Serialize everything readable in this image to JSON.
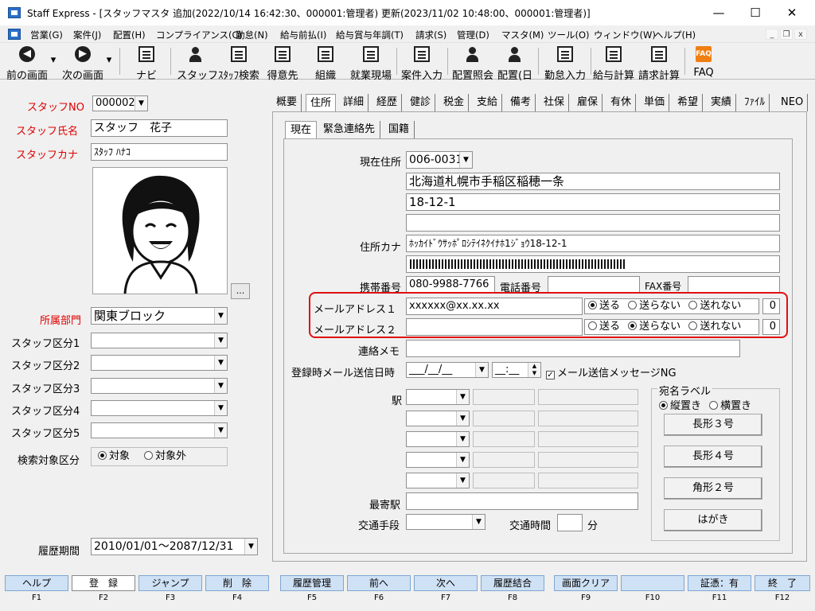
{
  "window": {
    "title": "Staff Express - [スタッフマスタ 追加(2022/10/14 16:42:30、000001:管理者) 更新(2023/11/02 10:48:00、000001:管理者)]",
    "minimize": "—",
    "maximize": "☐",
    "close": "✕"
  },
  "menu": {
    "items": [
      "営業(G)",
      "案件(J)",
      "配置(H)",
      "コンプライアンス(C)",
      "勤怠(N)",
      "給与前払(I)",
      "給与賞与年調(T)",
      "請求(S)",
      "管理(D)",
      "マスタ(M)",
      "ツール(O)",
      "ウィンドウ(W)",
      "ヘルプ(H)"
    ],
    "mdi_min": "_",
    "mdi_restore": "❐",
    "mdi_close": "x"
  },
  "toolbar": {
    "prev": "前の画面",
    "next": "次の画面",
    "navi": "ナビ",
    "staff": "スタッフ",
    "staff_search": "ｽﾀｯﾌ検索",
    "client": "得意先",
    "org": "組織",
    "site": "就業現場",
    "job_entry": "案件入力",
    "assign_view": "配置照会",
    "assign_day": "配置(日",
    "attendance": "勤怠入力",
    "payroll": "給与計算",
    "billing": "請求計算",
    "faq": "FAQ",
    "faq_icon": "FAQ"
  },
  "left": {
    "staff_no_label": "スタッフNO",
    "staff_no": "000002",
    "name_label": "スタッフ氏名",
    "name": "スタッフ　花子",
    "kana_label": "スタッフカナ",
    "kana": "ｽﾀｯﾌ ﾊﾅｺ",
    "photo_button": "...",
    "dept_label": "所属部門",
    "dept": "関東ブロック",
    "kubun1_label": "スタッフ区分1",
    "kubun2_label": "スタッフ区分2",
    "kubun3_label": "スタッフ区分3",
    "kubun4_label": "スタッフ区分4",
    "kubun5_label": "スタッフ区分5",
    "search_label": "検索対象区分",
    "search_opt1": "対象",
    "search_opt2": "対象外",
    "history_label": "履歴期間",
    "history": "2010/01/01～2087/12/31"
  },
  "tabs": [
    "概要",
    "住所",
    "詳細",
    "経歴",
    "健診",
    "税金",
    "支給",
    "備考",
    "社保",
    "雇保",
    "有休",
    "単価",
    "希望",
    "実績",
    "ﾌｧｲﾙ",
    "NEO"
  ],
  "active_tab": "住所",
  "subtabs": [
    "現在",
    "緊急連絡先",
    "国籍"
  ],
  "address": {
    "postal_label": "現在住所",
    "postal": "006-0031",
    "line1": "北海道札幌市手稲区稲穂一条",
    "line2": "18-12-1",
    "line3": "",
    "kana_label": "住所カナ",
    "kana": "ﾎｯｶｲﾄﾞｳｻｯﾎﾟﾛｼﾃｲﾈｸｲﾅﾎ1ｼﾞｮｳ18-12-1",
    "mobile_label": "携帯番号",
    "mobile": "080-9988-7766",
    "phone_label": "電話番号",
    "phone": "",
    "fax_label": "FAX番号",
    "fax": "",
    "mail1_label": "メールアドレス１",
    "mail1": "xxxxxx@xx.xx.xx",
    "mail2_label": "メールアドレス２",
    "mail2": "",
    "send": "送る",
    "no_send": "送らない",
    "cannot_send": "送れない",
    "mail1_count": "0",
    "mail2_count": "0",
    "memo_label": "連絡メモ",
    "reg_mail_label": "登録時メール送信日時",
    "reg_date": "___/__/__",
    "reg_time": "__:__",
    "ng_label": "メール送信メッセージNG",
    "station_label": "駅",
    "nearest_label": "最寄駅",
    "transport_label": "交通手段",
    "time_label": "交通時間",
    "minutes": "分"
  },
  "label_group": {
    "title": "宛名ラベル",
    "vertical": "縦置き",
    "horizontal": "横置き",
    "btn1": "長形３号",
    "btn2": "長形４号",
    "btn3": "角形２号",
    "btn4": "はがき"
  },
  "fkeys": [
    {
      "label": "ヘルプ",
      "key": "F1"
    },
    {
      "label": "登　録",
      "key": "F2"
    },
    {
      "label": "ジャンプ",
      "key": "F3"
    },
    {
      "label": "削　除",
      "key": "F4"
    },
    {
      "label": "履歴管理",
      "key": "F5"
    },
    {
      "label": "前へ",
      "key": "F6"
    },
    {
      "label": "次へ",
      "key": "F7"
    },
    {
      "label": "履歴結合",
      "key": "F8"
    },
    {
      "label": "画面クリア",
      "key": "F9"
    },
    {
      "label": "",
      "key": "F10"
    },
    {
      "label": "証憑：有",
      "key": "F11"
    },
    {
      "label": "終　了",
      "key": "F12"
    }
  ],
  "colors": {
    "label_red": "#e00000",
    "fkey_bg": "#cfe1f5",
    "highlight": "#e01010"
  }
}
